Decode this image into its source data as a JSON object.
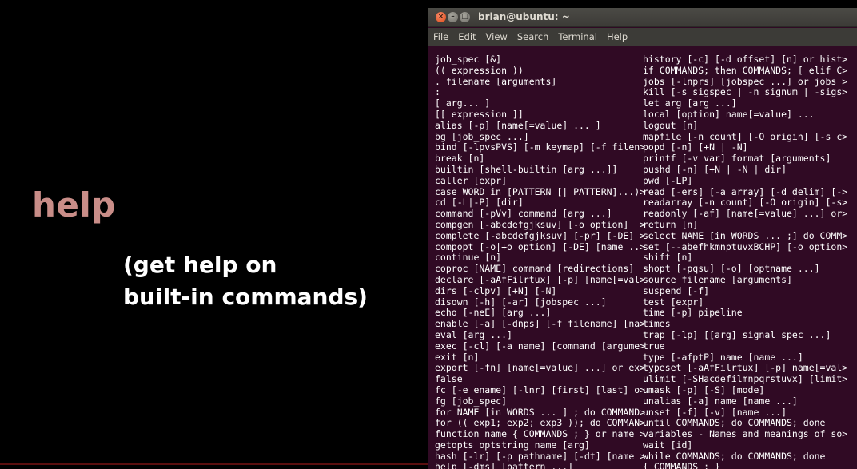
{
  "slide": {
    "title": "help",
    "description_lines": [
      "(get help on",
      "built-in commands)"
    ]
  },
  "window": {
    "title": "brian@ubuntu: ~",
    "buttons": {
      "close": "×",
      "minimize": "–",
      "maximize": "□"
    }
  },
  "menu": [
    "File",
    "Edit",
    "View",
    "Search",
    "Terminal",
    "Help"
  ],
  "colors": {
    "terminal_bg": "#300a24",
    "title_accent": "#c98d88"
  },
  "terminal": {
    "left_column": [
      "job_spec [&]",
      "(( expression ))",
      ". filename [arguments]",
      ":",
      "[ arg... ]",
      "[[ expression ]]",
      "alias [-p] [name[=value] ... ]",
      "bg [job_spec ...]",
      "bind [-lpvsPVS] [-m keymap] [-f filen>",
      "break [n]",
      "builtin [shell-builtin [arg ...]]",
      "caller [expr]",
      "case WORD in [PATTERN [| PATTERN]...)>",
      "cd [-L|-P] [dir]",
      "command [-pVv] command [arg ...]",
      "compgen [-abcdefgjksuv] [-o option]  >",
      "complete [-abcdefgjksuv] [-pr] [-DE] >",
      "compopt [-o|+o option] [-DE] [name ..>",
      "continue [n]",
      "coproc [NAME] command [redirections]",
      "declare [-aAfFilrtux] [-p] [name[=val>",
      "dirs [-clpv] [+N] [-N]",
      "disown [-h] [-ar] [jobspec ...]",
      "echo [-neE] [arg ...]",
      "enable [-a] [-dnps] [-f filename] [na>",
      "eval [arg ...]",
      "exec [-cl] [-a name] [command [argume>",
      "exit [n]",
      "export [-fn] [name[=value] ...] or ex>",
      "false",
      "fc [-e ename] [-lnr] [first] [last] o>",
      "fg [job_spec]",
      "for NAME [in WORDS ... ] ; do COMMAND>",
      "for (( exp1; exp2; exp3 )); do COMMAN>",
      "function name { COMMANDS ; } or name >",
      "getopts optstring name [arg]",
      "hash [-lr] [-p pathname] [-dt] [name >",
      "help [-dms] [pattern ...]"
    ],
    "right_column": [
      "history [-c] [-d offset] [n] or hist>",
      "if COMMANDS; then COMMANDS; [ elif C>",
      "jobs [-lnprs] [jobspec ...] or jobs >",
      "kill [-s sigspec | -n signum | -sigs>",
      "let arg [arg ...]",
      "local [option] name[=value] ...",
      "logout [n]",
      "mapfile [-n count] [-O origin] [-s c>",
      "popd [-n] [+N | -N]",
      "printf [-v var] format [arguments]",
      "pushd [-n] [+N | -N | dir]",
      "pwd [-LP]",
      "read [-ers] [-a array] [-d delim] [->",
      "readarray [-n count] [-O origin] [-s>",
      "readonly [-af] [name[=value] ...] or>",
      "return [n]",
      "select NAME [in WORDS ... ;] do COMM>",
      "set [--abefhkmnptuvxBCHP] [-o option>",
      "shift [n]",
      "shopt [-pqsu] [-o] [optname ...]",
      "source filename [arguments]",
      "suspend [-f]",
      "test [expr]",
      "time [-p] pipeline",
      "times",
      "trap [-lp] [[arg] signal_spec ...]",
      "true",
      "type [-afptP] name [name ...]",
      "typeset [-aAfFilrtux] [-p] name[=val>",
      "ulimit [-SHacdefilmnpqrstuvx] [limit>",
      "umask [-p] [-S] [mode]",
      "unalias [-a] name [name ...]",
      "unset [-f] [-v] [name ...]",
      "until COMMANDS; do COMMANDS; done",
      "variables - Names and meanings of so>",
      "wait [id]",
      "while COMMANDS; do COMMANDS; done",
      "{ COMMANDS ; }"
    ]
  }
}
